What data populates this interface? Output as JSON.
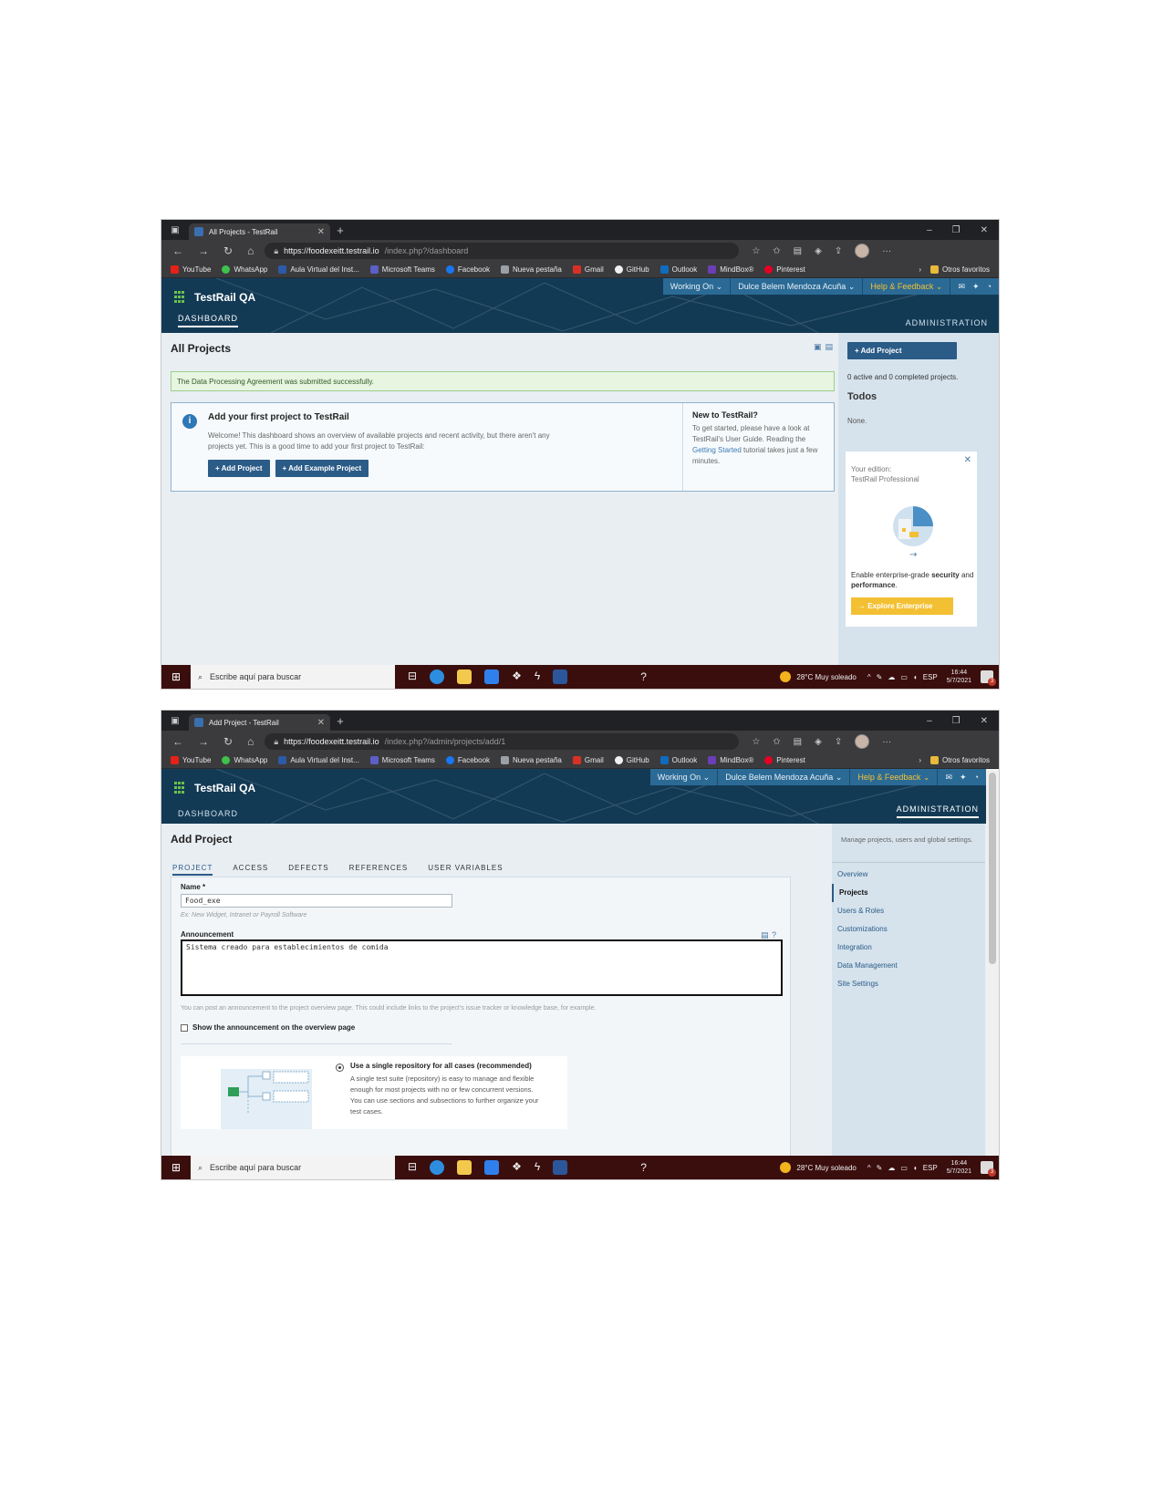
{
  "browser": {
    "window_controls": [
      "–",
      "❐",
      "✕"
    ],
    "bookmarks": [
      {
        "label": "YouTube",
        "color": "#e62117"
      },
      {
        "label": "WhatsApp",
        "color": "#3ec14b"
      },
      {
        "label": "Aula Virtual del Inst...",
        "color": "#2d5aa8"
      },
      {
        "label": "Microsoft Teams",
        "color": "#5b5fc7"
      },
      {
        "label": "Facebook",
        "color": "#1877f2"
      },
      {
        "label": "Nueva pestaña",
        "color": "#9aa0a6"
      },
      {
        "label": "Gmail",
        "color": "#d93025"
      },
      {
        "label": "GitHub",
        "color": "#f0f0f0"
      },
      {
        "label": "Outlook",
        "color": "#0f6cbd"
      },
      {
        "label": "MindBox®",
        "color": "#6a3fb5"
      },
      {
        "label": "Pinterest",
        "color": "#e60023"
      }
    ],
    "other_favorites": "Otros favoritos"
  },
  "testrail": {
    "app_name": "TestRail QA",
    "nav_dashboard": "DASHBOARD",
    "nav_administration": "ADMINISTRATION",
    "working_on": "Working On",
    "user": "Dulce Belem Mendoza Acuña",
    "help": "Help & Feedback"
  },
  "shot1": {
    "tab_title": "All Projects - TestRail",
    "url_host": "https://foodexeitt.testrail.io",
    "url_path": "/index.php?/dashboard",
    "page_title": "All Projects",
    "success_message": "The Data Processing Agreement was submitted successfully.",
    "welcome_title": "Add your first project to TestRail",
    "welcome_text": "Welcome! This dashboard shows an overview of available projects and recent activity, but there aren't any projects yet. This is a good time to add your first project to TestRail:",
    "btn_add_project": "+ Add Project",
    "btn_add_example": "+ Add Example Project",
    "new_to_title": "New to TestRail?",
    "new_to_text_1": "To get started, please have a look at TestRail's User Guide. Reading the ",
    "new_to_link": "Getting Started",
    "new_to_text_2": " tutorial takes just a few minutes.",
    "side_add_project": "+ Add Project",
    "counts_text": "0 active and 0 completed projects.",
    "todos_title": "Todos",
    "todos_none": "None.",
    "promo_edition_label": "Your edition:",
    "promo_edition": "TestRail Professional",
    "promo_text_1": "Enable enterprise-grade ",
    "promo_bold_1": "security",
    "promo_text_2": " and ",
    "promo_bold_2": "performance",
    "promo_text_3": ".",
    "promo_button": "→ Explore Enterprise"
  },
  "shot2": {
    "tab_title": "Add Project - TestRail",
    "url_host": "https://foodexeitt.testrail.io",
    "url_path": "/index.php?/admin/projects/add/1",
    "page_title": "Add Project",
    "tabs": [
      "PROJECT",
      "ACCESS",
      "DEFECTS",
      "REFERENCES",
      "USER VARIABLES"
    ],
    "name_label": "Name *",
    "name_value": "Food_exe",
    "name_hint": "Ex: New Widget, Intranet or Payroll Software",
    "announcement_label": "Announcement",
    "announcement_value": "Sistema creado para establecimientos de comida",
    "announcement_help": "You can post an announcement to the project overview page. This could include links to the project's issue tracker or knowledge base, for example.",
    "show_announcement": "Show the announcement on the overview page",
    "repo_option_title": "Use a single repository for all cases (recommended)",
    "repo_option_desc": "A single test suite (repository) is easy to manage and flexible enough for most projects with no or few concurrent versions. You can use sections and subsections to further organize your test cases.",
    "side_desc": "Manage projects, users and global settings.",
    "admin_menu": [
      "Overview",
      "Projects",
      "Users & Roles",
      "Customizations",
      "Integration",
      "Data Management",
      "Site Settings"
    ]
  },
  "taskbar": {
    "search_placeholder": "Escribe aquí para buscar",
    "weather": "28°C  Muy soleado",
    "language": "ESP",
    "time": "16:44",
    "date": "5/7/2021",
    "notifications": "3"
  }
}
